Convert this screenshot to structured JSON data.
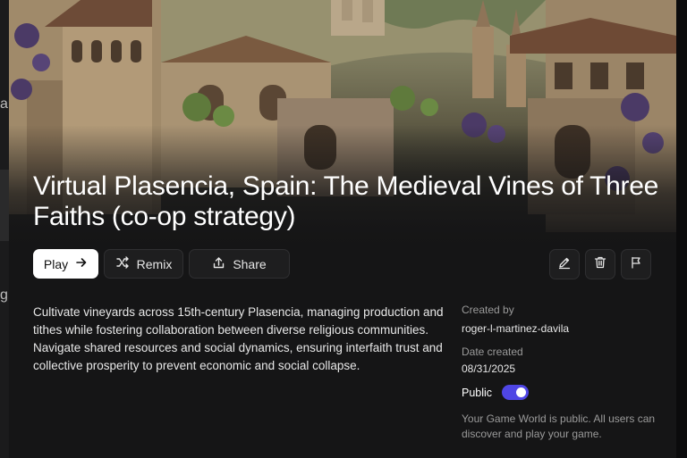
{
  "game": {
    "title": "Virtual Plasencia, Spain: The Medieval Vines of Three Faiths (co-op strategy)",
    "description": "Cultivate vineyards across 15th-century Plasencia, managing production and tithes while fostering collaboration between diverse religious communities. Navigate shared resources and social dynamics, ensuring interfaith trust and collective prosperity to prevent economic and social collapse."
  },
  "actions": {
    "play_label": "Play",
    "remix_label": "Remix",
    "share_label": "Share"
  },
  "icons": {
    "play": "arrow-right-icon",
    "remix": "shuffle-icon",
    "share": "upload-share-icon",
    "edit": "pencil-icon",
    "delete": "trash-icon",
    "report": "flag-icon"
  },
  "meta": {
    "created_by_label": "Created by",
    "created_by": "roger-l-martinez-davila",
    "date_created_label": "Date created",
    "date_created": "08/31/2025",
    "public_label": "Public",
    "public": true,
    "public_note": "Your Game World is public. All users can discover and play your game."
  },
  "background": {
    "fragments": [
      "ar",
      "g"
    ]
  },
  "colors": {
    "toggle_on": "#4f46e5",
    "modal_bg": "#151516",
    "play_button_bg": "#ffffff"
  }
}
